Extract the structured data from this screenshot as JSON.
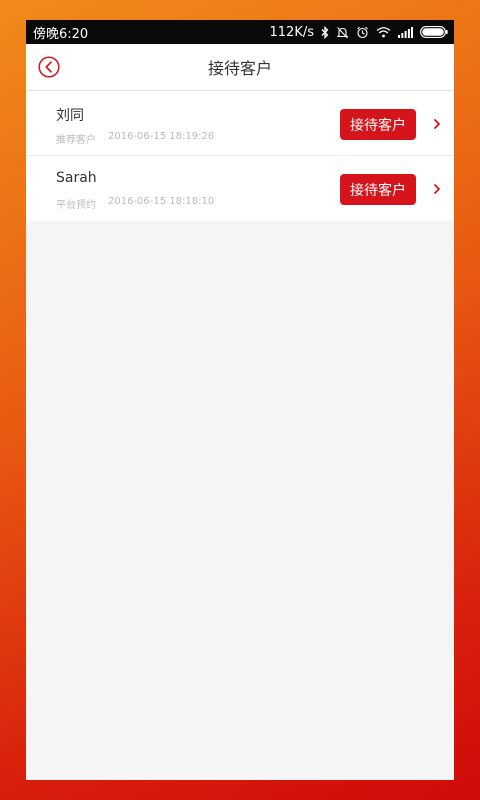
{
  "status_bar": {
    "time": "傍晚6:20",
    "speed": "112K/s"
  },
  "header": {
    "title": "接待客户",
    "accent": "#d5141b"
  },
  "customers": [
    {
      "name": "刘同",
      "source": "推荐客户",
      "time": "2016-06-15 18:19:26",
      "button_label": "接待客户"
    },
    {
      "name": "Sarah",
      "source": "平台预约",
      "time": "2016-06-15 18:18:10",
      "button_label": "接待客户"
    }
  ]
}
